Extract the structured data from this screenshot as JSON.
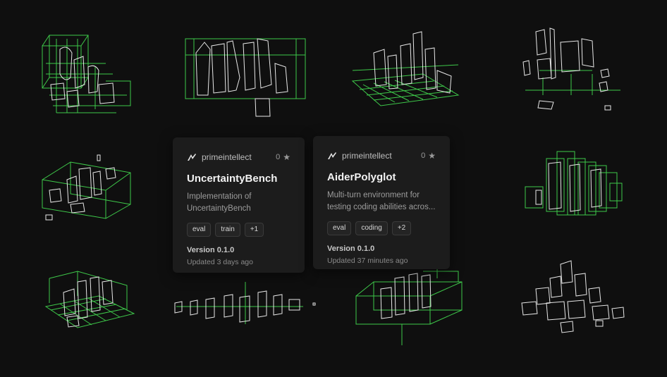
{
  "cards": [
    {
      "org": "primeintellect",
      "stars": "0",
      "title": "UncertaintyBench",
      "description": "Implementation of UncertaintyBench",
      "tags": [
        "eval",
        "train",
        "+1"
      ],
      "version": "Version 0.1.0",
      "updated": "Updated 3 days ago"
    },
    {
      "org": "primeintellect",
      "stars": "0",
      "title": "AiderPolyglot",
      "description": "Multi-turn environment for testing coding abilities acros...",
      "tags": [
        "eval",
        "coding",
        "+2"
      ],
      "version": "Version 0.1.0",
      "updated": "Updated 37 minutes ago"
    }
  ],
  "colors": {
    "background": "#0f0f0f",
    "card": "#1c1c1c",
    "wireframe_green": "#3ec94a",
    "wireframe_white": "#e8e8e8"
  },
  "icons": {
    "org_logo": "primeintellect-logo-icon",
    "star": "star-icon"
  }
}
